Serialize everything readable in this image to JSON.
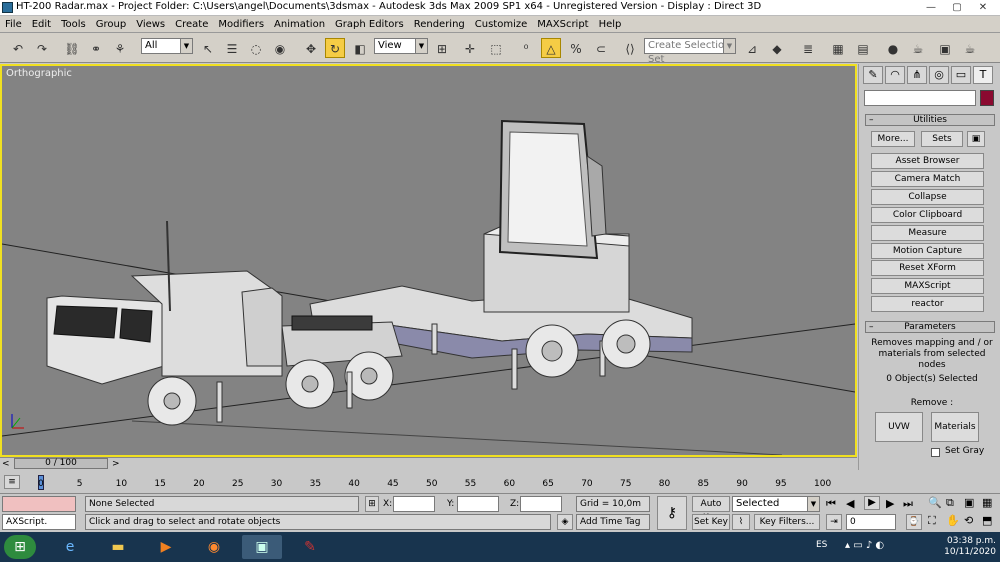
{
  "window": {
    "title": "HT-200 Radar.max  - Project Folder: C:\\Users\\angel\\Documents\\3dsmax   - Autodesk 3ds Max  2009 SP1  x64   - Unregistered Version    - Display : Direct 3D",
    "min_label": "—",
    "max_label": "▢",
    "close_label": "✕"
  },
  "menu": [
    "File",
    "Edit",
    "Tools",
    "Group",
    "Views",
    "Create",
    "Modifiers",
    "Animation",
    "Graph Editors",
    "Rendering",
    "Customize",
    "MAXScript",
    "Help"
  ],
  "toolbar": {
    "filter_value": "All",
    "refcoord_value": "View",
    "selection_set_placeholder": "Create Selection Set"
  },
  "viewport": {
    "label": "Orthographic"
  },
  "command_panel": {
    "utilities_title": "Utilities",
    "more_label": "More...",
    "sets_label": "Sets",
    "buttons": [
      "Asset Browser",
      "Camera Match",
      "Collapse",
      "Color Clipboard",
      "Measure",
      "Motion Capture",
      "Reset XForm",
      "MAXScript",
      "reactor"
    ],
    "parameters_title": "Parameters",
    "param_desc": "Removes mapping and / or materials from selected nodes",
    "selected_count": "0 Object(s) Selected",
    "remove_label": "Remove :",
    "uvw_label": "UVW",
    "materials_label": "Materials",
    "setgray_label": "Set Gray"
  },
  "time": {
    "slider_label": "0 / 100",
    "ticks": [
      "0",
      "5",
      "10",
      "15",
      "20",
      "25",
      "30",
      "35",
      "40",
      "45",
      "50",
      "55",
      "60",
      "65",
      "70",
      "75",
      "80",
      "85",
      "90",
      "95",
      "100"
    ]
  },
  "status": {
    "maxscript_label": "AXScript.",
    "selection": "None Selected",
    "prompt": "Click and drag to select and rotate objects",
    "x_label": "X:",
    "y_label": "Y:",
    "z_label": "Z:",
    "grid": "Grid = 10,0m",
    "add_time_tag": "Add Time Tag",
    "auto_key": "Auto Key",
    "set_key": "Set Key",
    "key_mode_value": "Selected",
    "key_filters": "Key Filters...",
    "frame_value": "0"
  },
  "taskbar": {
    "lang": "ES",
    "time": "03:38 p.m.",
    "date": "10/11/2020"
  },
  "colors": {
    "viewport_bg": "#838383",
    "active_border": "#f0e020",
    "taskbar": "#18344e",
    "active_tool": "#f5cc45",
    "color_swatch": "#8b0a30"
  }
}
